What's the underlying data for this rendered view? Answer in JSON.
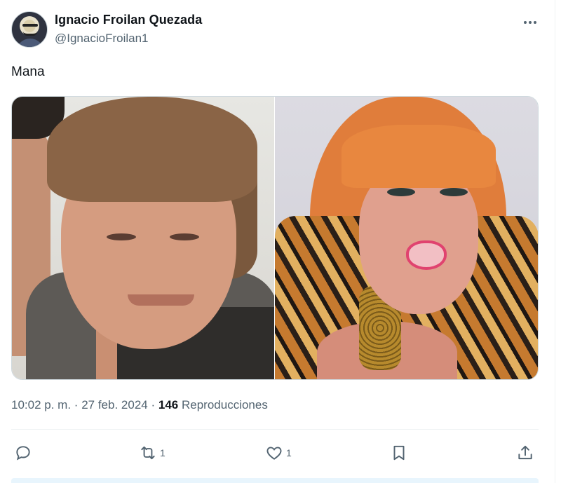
{
  "author": {
    "name": "Ignacio Froilan Quezada",
    "handle": "@IgnacioFroilan1",
    "avatar_icon": "guy-fawkes-mask-avatar"
  },
  "tweet": {
    "text": "Mana"
  },
  "media": {
    "image_count": 2
  },
  "meta": {
    "time": "10:02 p. m.",
    "dot1": "·",
    "date": "27 feb. 2024",
    "dot2": "·",
    "views_count": "146",
    "views_label": "Reproducciones"
  },
  "actions": {
    "reply_count": "",
    "retweet_count": "1",
    "like_count": "1",
    "bookmark_count": "",
    "reply_icon": "reply-icon",
    "retweet_icon": "retweet-icon",
    "like_icon": "heart-icon",
    "bookmark_icon": "bookmark-icon",
    "share_icon": "share-icon"
  },
  "colors": {
    "text_primary": "#0f1419",
    "text_secondary": "#536471",
    "border": "#cfd9de"
  }
}
